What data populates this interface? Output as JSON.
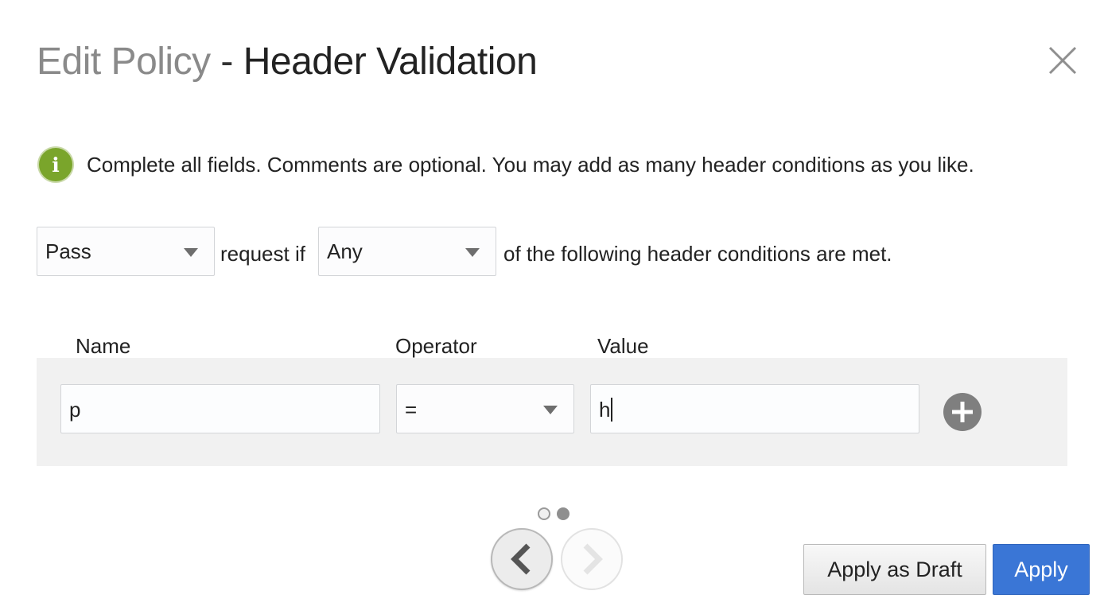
{
  "dialog": {
    "title_main": "Edit Policy",
    "title_separator": " - ",
    "title_sub": "Header Validation",
    "close_icon": "close-icon"
  },
  "info": {
    "icon": "info-icon",
    "icon_glyph": "i",
    "icon_color": "#7aa52b",
    "text": "Complete all fields. Comments are optional. You may add as many header conditions as you like."
  },
  "rule": {
    "action_value": "Pass",
    "connector_1": "request if",
    "match_value": "Any",
    "connector_2": "of the following header conditions are met."
  },
  "conditions": {
    "columns": [
      "Name",
      "Operator",
      "Value"
    ],
    "rows": [
      {
        "name": "p",
        "operator": "=",
        "value": "h"
      }
    ],
    "add_icon": "plus-circle-icon"
  },
  "pager": {
    "current_page": 2,
    "total_pages": 2,
    "prev_icon": "chevron-left-icon",
    "next_icon": "chevron-right-icon"
  },
  "footer": {
    "draft_label": "Apply as Draft",
    "apply_label": "Apply",
    "apply_color": "#3a76d6"
  }
}
